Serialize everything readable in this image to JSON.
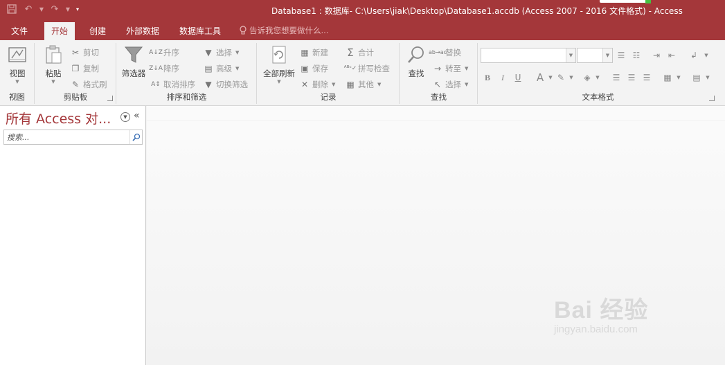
{
  "titlebar": {
    "title": "Database1 : 数据库- C:\\Users\\jiak\\Desktop\\Database1.accdb (Access 2007 - 2016 文件格式) - Access"
  },
  "tabs": [
    {
      "label": "文件"
    },
    {
      "label": "开始"
    },
    {
      "label": "创建"
    },
    {
      "label": "外部数据"
    },
    {
      "label": "数据库工具"
    }
  ],
  "tellme": {
    "placeholder": "告诉我您想要做什么..."
  },
  "ribbon": {
    "view": {
      "btn": "视图",
      "label": "视图"
    },
    "clipboard": {
      "paste": "粘贴",
      "cut": "剪切",
      "copy": "复制",
      "painter": "格式刷",
      "label": "剪贴板"
    },
    "sort": {
      "filter": "筛选器",
      "asc": "升序",
      "desc": "降序",
      "clear": "取消排序",
      "select": "选择",
      "advanced": "高级",
      "toggle": "切换筛选",
      "label": "排序和筛选"
    },
    "records": {
      "refresh": "全部刷新",
      "new": "新建",
      "save": "保存",
      "delete": "删除",
      "totals": "合计",
      "spell": "拼写检查",
      "more": "其他",
      "label": "记录"
    },
    "find": {
      "find": "查找",
      "replace": "替换",
      "goto": "转至",
      "select": "选择",
      "label": "查找"
    },
    "text": {
      "label": "文本格式"
    }
  },
  "navpane": {
    "title": "所有 Access 对...",
    "search_placeholder": "搜索..."
  },
  "watermark": {
    "main": "Bai 经验",
    "sub": "jingyan.baidu.com"
  },
  "colors": {
    "accent": "#a4373a"
  }
}
